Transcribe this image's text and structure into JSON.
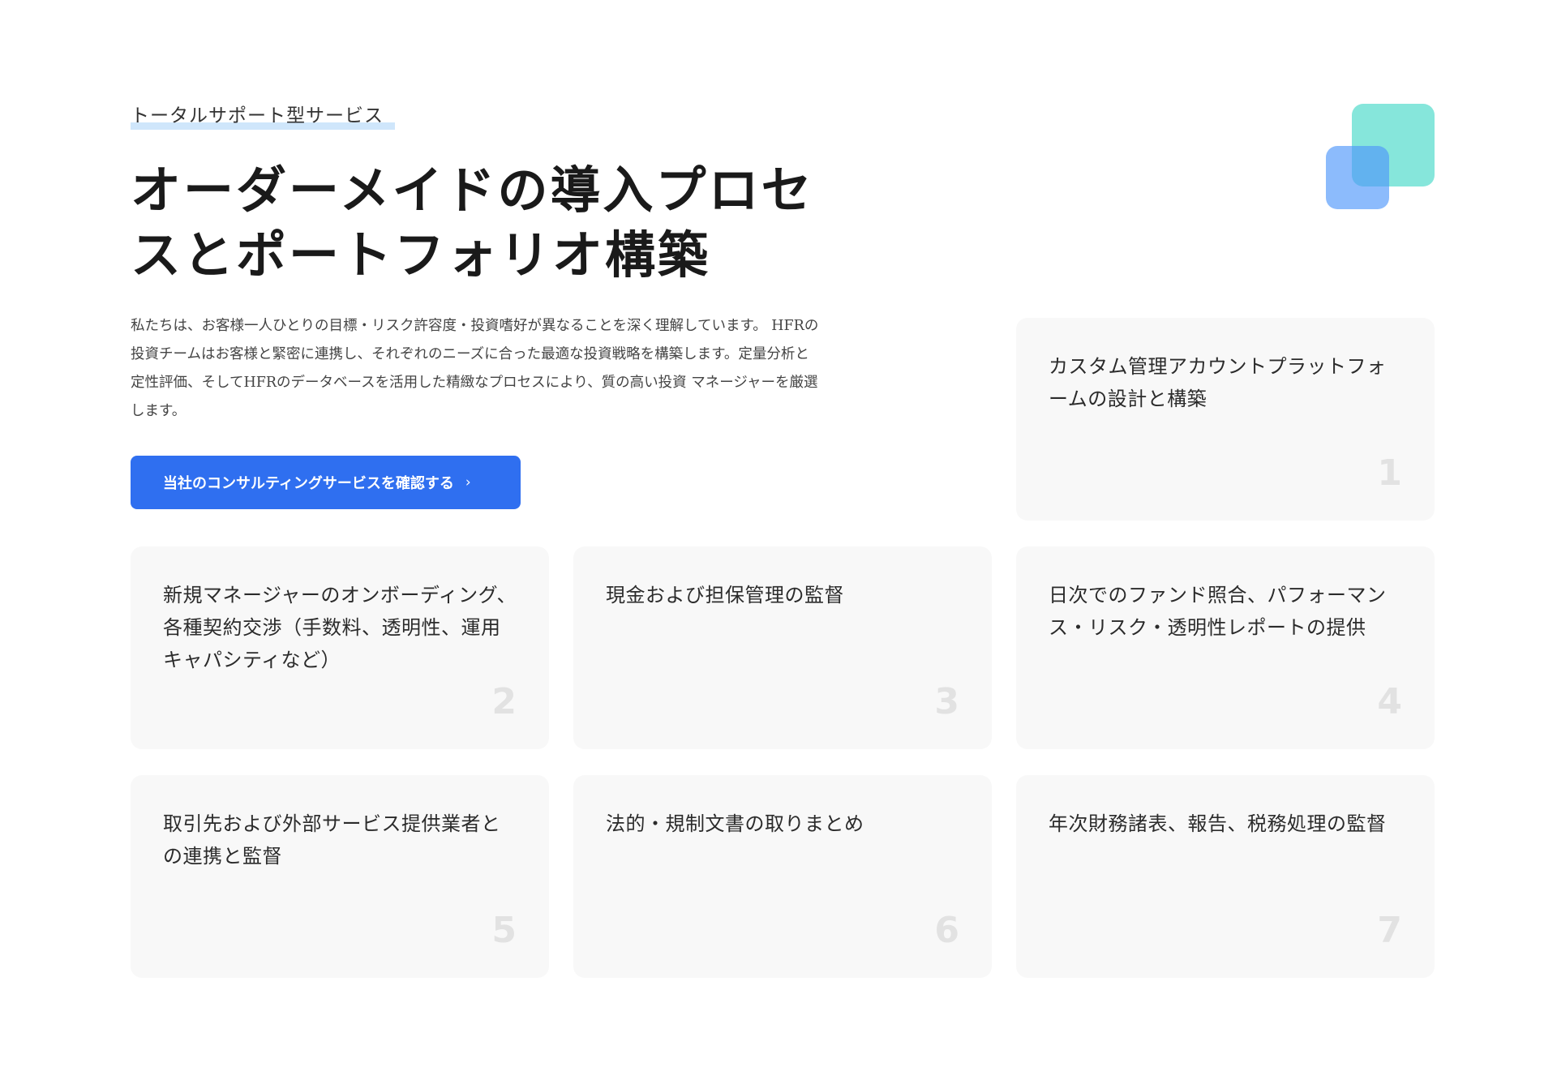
{
  "section": {
    "eyebrow": "トータルサポート型サービス",
    "headline": "オーダーメイドの導入プロセスとポートフォリオ構築",
    "description": "私たちは、お客様一人ひとりの目標・リスク許容度・投資嗜好が異なることを深く理解しています。 HFRの投資チームはお客様と緊密に連携し、それぞれのニーズに合った最適な投資戦略を構築します。定量分析と定性評価、そしてHFRのデータベースを活用した精緻なプロセスにより、質の高い投資 マネージャーを厳選します。",
    "cta_label": "当社のコンサルティングサービスを確認する",
    "cta_icon": "chevron-right-icon"
  },
  "colors": {
    "accent": "#2f6ff0",
    "eyebrow_underline": "#cfe6fb",
    "deco_teal": "#86e6db",
    "deco_blue": "#4f97fb",
    "card_bg": "#f8f8f8",
    "card_number": "#e2e2e2"
  },
  "cards": [
    {
      "number": "1",
      "text": "カスタム管理アカウントプラットフォームの設計と構築"
    },
    {
      "number": "2",
      "text": "新規マネージャーのオンボーディング、各種契約交渉（手数料、透明性、運用キャパシティなど）"
    },
    {
      "number": "3",
      "text": "現金および担保管理の監督"
    },
    {
      "number": "4",
      "text": "日次でのファンド照合、パフォーマンス・リスク・透明性レポートの提供"
    },
    {
      "number": "5",
      "text": "取引先および外部サービス提供業者との連携と監督"
    },
    {
      "number": "6",
      "text": "法的・規制文書の取りまとめ"
    },
    {
      "number": "7",
      "text": "年次財務諸表、報告、税務処理の監督"
    }
  ]
}
